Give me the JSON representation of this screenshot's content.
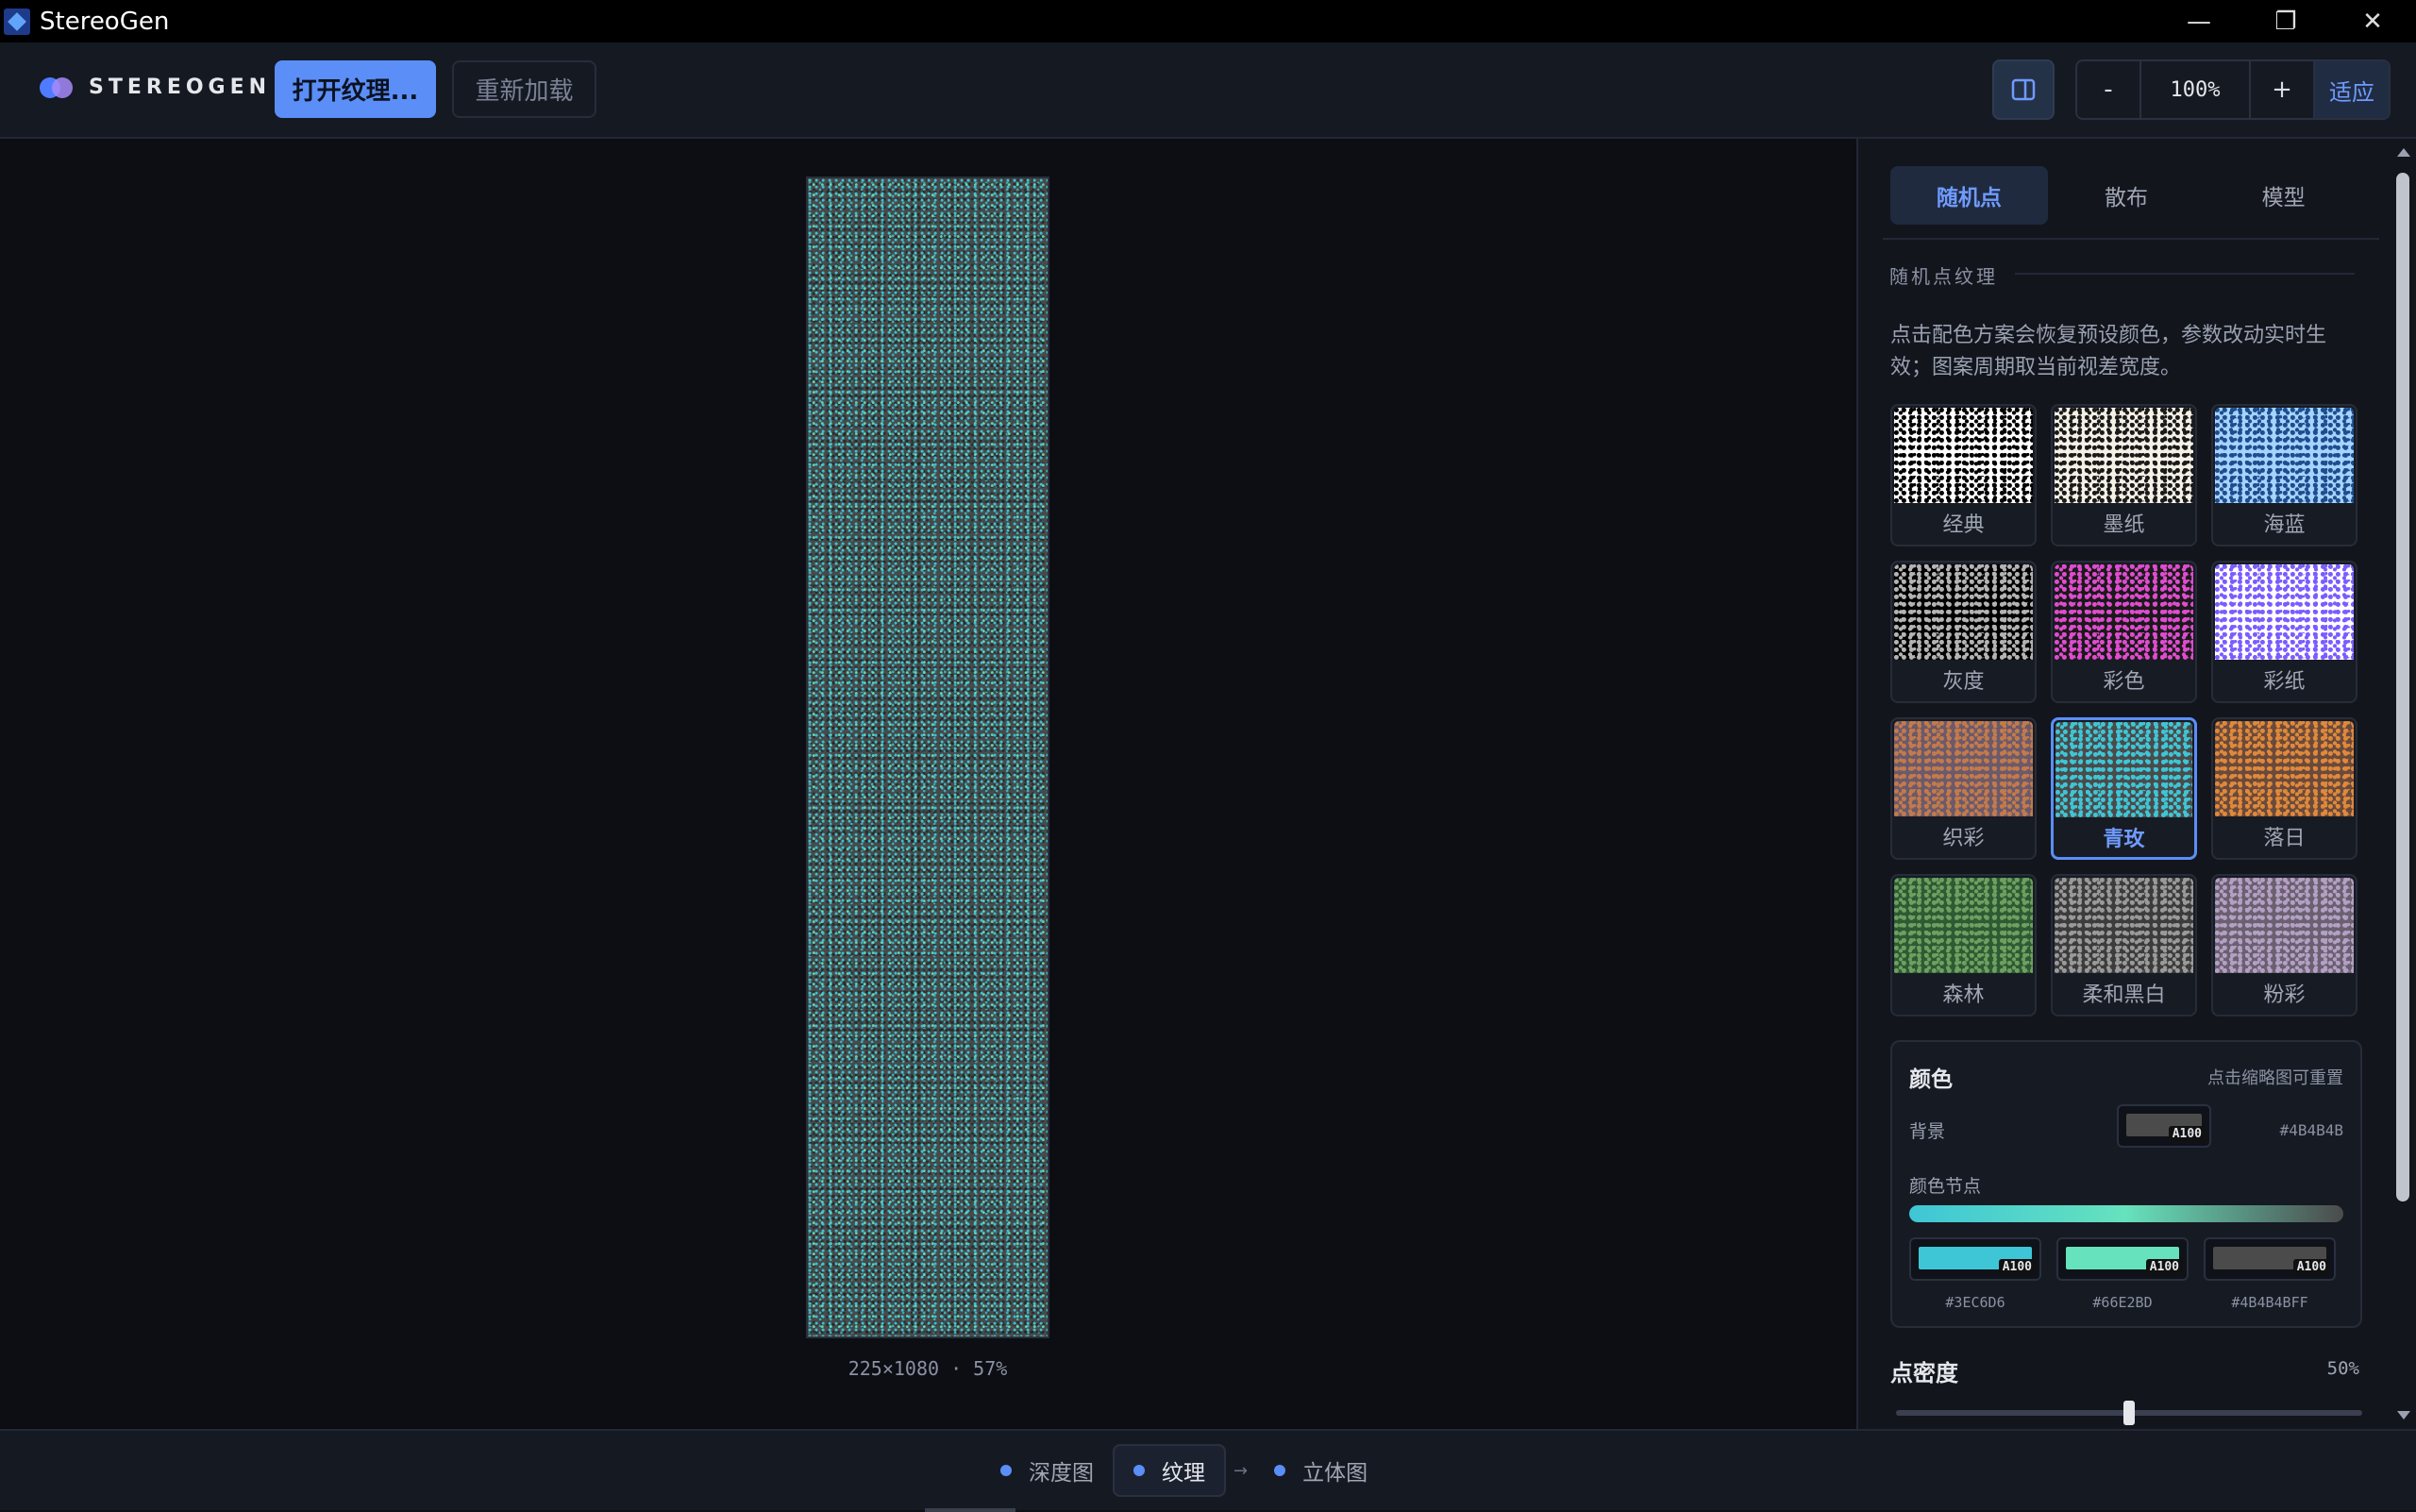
{
  "window": {
    "title": "StereoGen",
    "controls": [
      "—",
      "❐",
      "✕"
    ]
  },
  "toolbar": {
    "brand": "STEREOGEN",
    "open_label": "打开纹理...",
    "reload_label": "重新加载",
    "zoom_minus": "-",
    "zoom_value": "100%",
    "zoom_plus": "+",
    "zoom_fit": "适应"
  },
  "canvas": {
    "caption": "225×1080 · 57%"
  },
  "panel": {
    "tabs": [
      {
        "label": "随机点",
        "active": true
      },
      {
        "label": "散布",
        "active": false
      },
      {
        "label": "模型",
        "active": false
      }
    ],
    "section_title": "随机点纹理",
    "description": "点击配色方案会恢复预设颜色，参数改动实时生效；图案周期取当前视差宽度。",
    "presets": [
      {
        "label": "经典",
        "colors": [
          "#ffffff",
          "#000000"
        ]
      },
      {
        "label": "墨纸",
        "colors": [
          "#f5f0e6",
          "#1a1a1a"
        ]
      },
      {
        "label": "海蓝",
        "colors": [
          "#a5d3ff",
          "#1e4c8c"
        ]
      },
      {
        "label": "灰度",
        "colors": [
          "#000000",
          "#b4b4b4"
        ]
      },
      {
        "label": "彩色",
        "colors": [
          "#1a1a1a",
          "#e04cd0"
        ]
      },
      {
        "label": "彩纸",
        "colors": [
          "#ffffff",
          "#7a5cff"
        ]
      },
      {
        "label": "织彩",
        "colors": [
          "#6a5a6c",
          "#c47a4a"
        ]
      },
      {
        "label": "青玫",
        "colors": [
          "#4b4b4b",
          "#3ec6d6"
        ],
        "active": true
      },
      {
        "label": "落日",
        "colors": [
          "#6a4a3c",
          "#e0893a"
        ]
      },
      {
        "label": "森林",
        "colors": [
          "#2e5a34",
          "#6ea060"
        ]
      },
      {
        "label": "柔和黑白",
        "colors": [
          "#3c3c3c",
          "#9a9a9a"
        ]
      },
      {
        "label": "粉彩",
        "colors": [
          "#6a6070",
          "#b4a0c4"
        ]
      }
    ],
    "color": {
      "title": "颜色",
      "hint": "点击缩略图可重置",
      "bg_label": "背景",
      "bg_alpha": "A100",
      "bg_hex": "#4B4B4B",
      "bg_color": "#4b4b4b",
      "nodes_label": "颜色节点",
      "nodes": [
        {
          "color": "#3ec6d6",
          "alpha": "A100",
          "hex": "#3EC6D6"
        },
        {
          "color": "#66e2bd",
          "alpha": "A100",
          "hex": "#66E2BD"
        },
        {
          "color": "#4b4b4b",
          "alpha": "A100",
          "hex": "#4B4B4BFF"
        }
      ]
    },
    "density": {
      "label": "点密度",
      "value_text": "50%",
      "value": 0.5
    }
  },
  "bottom": {
    "steps": [
      {
        "label": "深度图",
        "active": false
      },
      {
        "label": "纹理",
        "active": true
      },
      {
        "label": "立体图",
        "active": false
      }
    ],
    "arrow": "→"
  }
}
